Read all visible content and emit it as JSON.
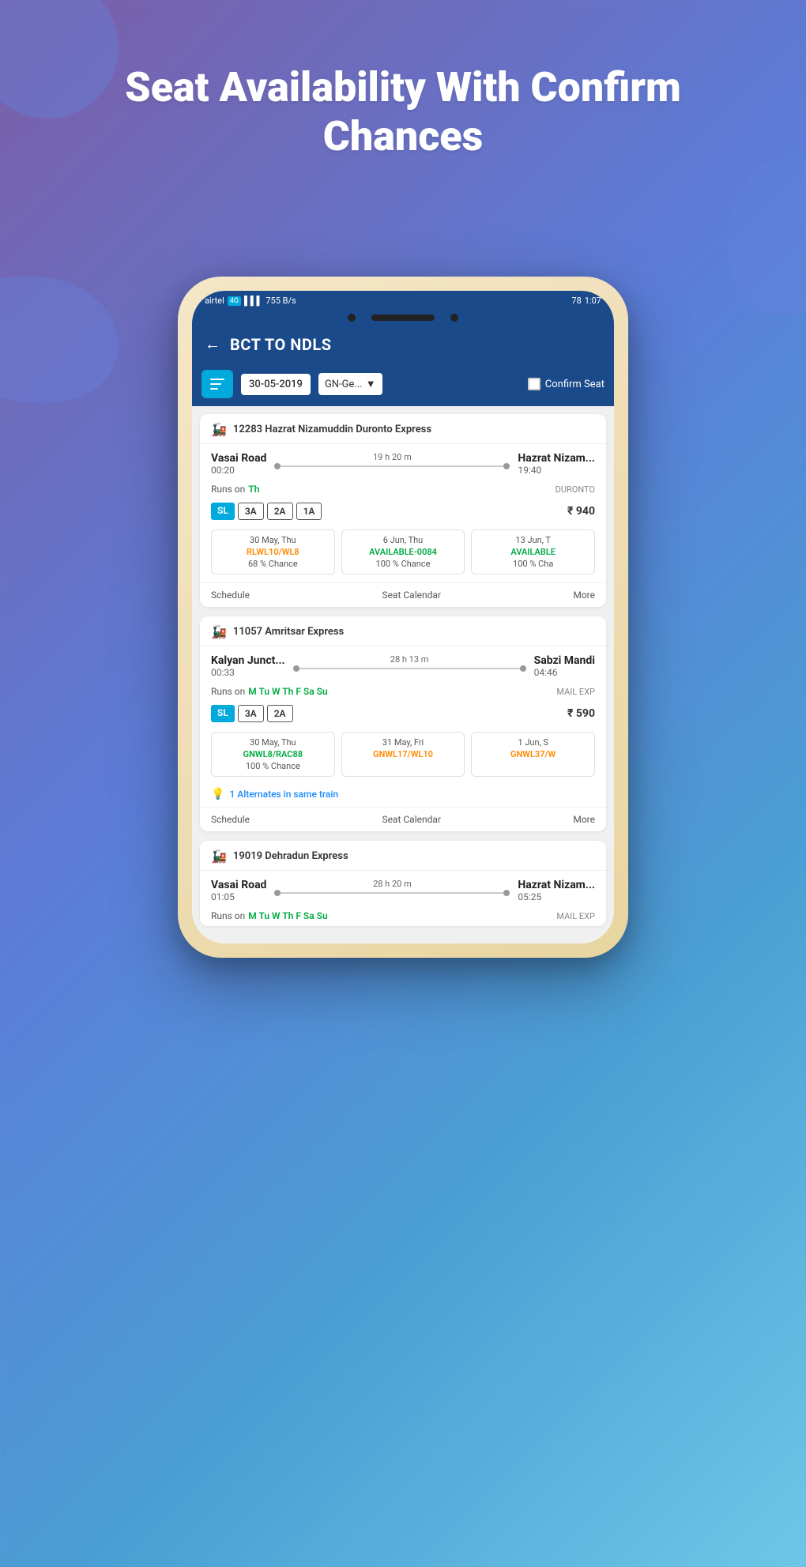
{
  "page": {
    "title_line1": "Seat Availability With Confirm",
    "title_line2": "Chances"
  },
  "status_bar": {
    "carrier": "airtel",
    "network": "4G",
    "speed": "755 B/s",
    "battery": "78",
    "time": "1:07"
  },
  "app": {
    "back_label": "←",
    "title": "BCT TO NDLS"
  },
  "filter": {
    "date": "30-05-2019",
    "class": "GN-Ge...",
    "confirm_seat_label": "Confirm Seat"
  },
  "trains": [
    {
      "number": "12283",
      "name": "Hazrat Nizamuddin Duronto Express",
      "from_station": "Vasai Road",
      "from_time": "00:20",
      "to_station": "Hazrat Nizam...",
      "to_time": "19:40",
      "duration": "19 h 20 m",
      "runs_on": "Th",
      "runs_days": [
        "Th"
      ],
      "train_type": "DURONTO",
      "price": "₹ 940",
      "classes": [
        "SL",
        "3A",
        "2A",
        "1A"
      ],
      "availability": [
        {
          "date": "30 May, Thu",
          "status": "RLWL10/WL8",
          "chance": "68 % Chance",
          "status_color": "orange"
        },
        {
          "date": "6 Jun, Thu",
          "status": "AVAILABLE-0084",
          "chance": "100 % Chance",
          "status_color": "green"
        },
        {
          "date": "13 Jun, T",
          "status": "AVAILABLE",
          "chance": "100 % Cha",
          "status_color": "green",
          "partial": true
        }
      ],
      "footer": [
        "Schedule",
        "Seat Calendar",
        "More"
      ],
      "alternates": null
    },
    {
      "number": "11057",
      "name": "Amritsar Express",
      "from_station": "Kalyan Junct...",
      "from_time": "00:33",
      "to_station": "Sabzi Mandi",
      "to_time": "04:46",
      "duration": "28 h 13 m",
      "runs_on": "M Tu W Th F Sa Su",
      "runs_days": [
        "M",
        "Tu",
        "W",
        "Th",
        "F",
        "Sa",
        "Su"
      ],
      "train_type": "MAIL EXP",
      "price": "₹ 590",
      "classes": [
        "SL",
        "3A",
        "2A"
      ],
      "availability": [
        {
          "date": "30 May, Thu",
          "status": "GNWL8/RAC88",
          "chance": "100 % Chance",
          "status_color": "green"
        },
        {
          "date": "31 May, Fri",
          "status": "GNWL17/WL10",
          "chance": "",
          "status_color": "orange"
        },
        {
          "date": "1 Jun, S",
          "status": "GNWL37/W",
          "chance": "",
          "status_color": "orange",
          "partial": true
        }
      ],
      "footer": [
        "Schedule",
        "Seat Calendar",
        "More"
      ],
      "alternates": "1 Alternates in same train"
    },
    {
      "number": "19019",
      "name": "Dehradun Express",
      "from_station": "Vasai Road",
      "from_time": "01:05",
      "to_station": "Hazrat Nizam...",
      "to_time": "05:25",
      "duration": "28 h 20 m",
      "runs_on": "M Tu W Th F Sa Su",
      "runs_days": [
        "M",
        "Tu",
        "W",
        "Th",
        "F",
        "Sa",
        "Su"
      ],
      "train_type": "MAIL EXP",
      "price": "",
      "classes": [],
      "availability": [],
      "footer": [],
      "alternates": null
    }
  ]
}
